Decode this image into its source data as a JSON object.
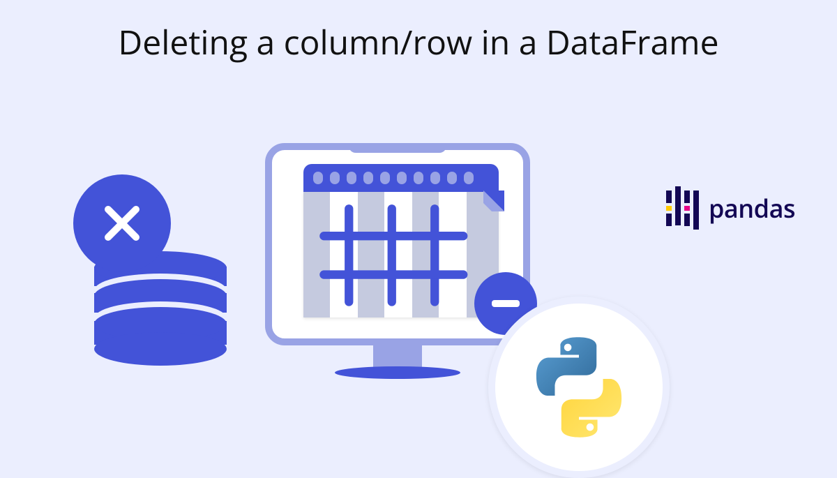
{
  "title": "Deleting a column/row in a DataFrame",
  "logos": {
    "pandas_text": "pandas"
  },
  "colors": {
    "primary_blue": "#4353d8",
    "light_blue": "#99a3e5",
    "background": "#ebeefe",
    "pandas_navy": "#130754",
    "pandas_pink": "#e70488",
    "pandas_yellow": "#ffca00",
    "python_blue": "#3d6e93",
    "python_yellow": "#f7cb3d"
  },
  "icons": {
    "x_badge": "close-icon",
    "minus_badge": "minus-icon",
    "database": "database-icon",
    "monitor": "monitor-icon",
    "spreadsheet": "spreadsheet-icon",
    "python": "python-icon",
    "pandas": "pandas-icon"
  }
}
